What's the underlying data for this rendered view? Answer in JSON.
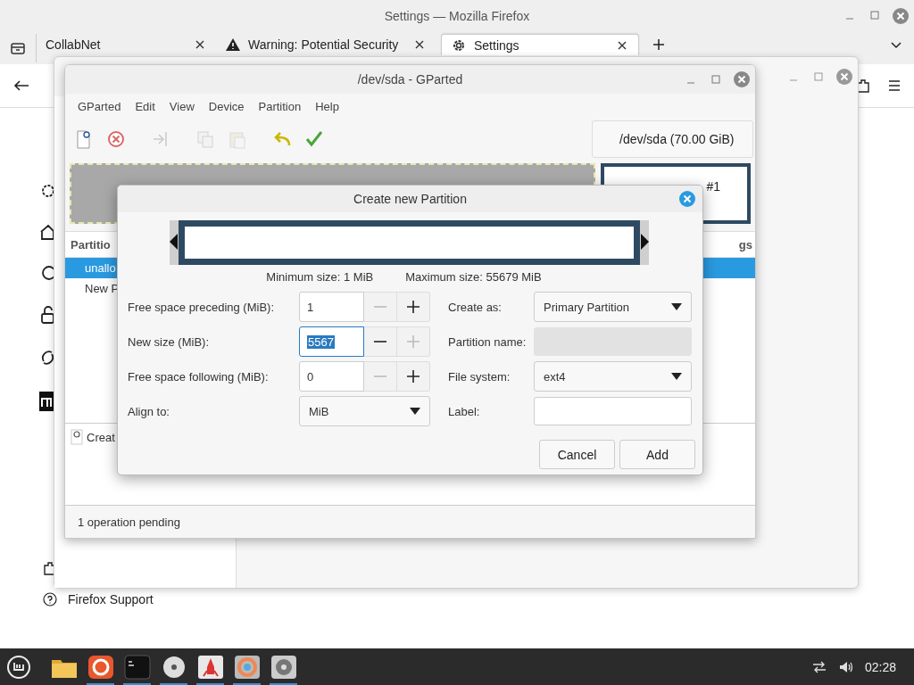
{
  "firefox": {
    "title": "Settings — Mozilla Firefox",
    "tabs": [
      {
        "label": "CollabNet",
        "kind": "plain",
        "selected": false
      },
      {
        "label": "Warning: Potential Security",
        "kind": "warning",
        "selected": false
      },
      {
        "label": "Settings",
        "kind": "settings",
        "selected": true
      }
    ],
    "support_link": "Firefox Support"
  },
  "gparted": {
    "title": "/dev/sda - GParted",
    "menu": [
      "GParted",
      "Edit",
      "View",
      "Device",
      "Partition",
      "Help"
    ],
    "toolbar": [
      {
        "kind": "new",
        "disabled": false
      },
      {
        "kind": "delete",
        "disabled": false
      },
      {
        "kind": "resize",
        "disabled": true
      },
      {
        "kind": "copy",
        "disabled": true
      },
      {
        "kind": "paste",
        "disabled": true
      },
      {
        "kind": "undo",
        "disabled": false
      },
      {
        "kind": "apply",
        "disabled": false
      }
    ],
    "device": "/dev/sda (70.00 GiB)",
    "map_label": "#1",
    "columns": [
      "Partitio",
      "gs"
    ],
    "rows": [
      {
        "text": "unallo",
        "selected": true
      },
      {
        "text": "New P",
        "selected": false
      }
    ],
    "operations": [
      "Creat"
    ],
    "status": "1 operation pending"
  },
  "dialog": {
    "title": "Create new Partition",
    "min_size": "Minimum size: 1 MiB",
    "max_size": "Maximum size: 55679 MiB",
    "left_fields": [
      {
        "label": "Free space preceding (MiB):",
        "kind": "spin",
        "value": "1",
        "text_selected": false,
        "minus_disabled": true,
        "plus_disabled": false
      },
      {
        "label": "New size (MiB):",
        "kind": "spin",
        "value": "5567",
        "text_selected": true,
        "minus_disabled": false,
        "plus_disabled": true
      },
      {
        "label": "Free space following (MiB):",
        "kind": "spin",
        "value": "0",
        "text_selected": false,
        "minus_disabled": true,
        "plus_disabled": false
      },
      {
        "label": "Align to:",
        "kind": "combo",
        "value": "MiB"
      }
    ],
    "right_fields": [
      {
        "label": "Create as:",
        "kind": "combo",
        "value": "Primary Partition"
      },
      {
        "label": "Partition name:",
        "kind": "entry",
        "disabled": true
      },
      {
        "label": "File system:",
        "kind": "combo",
        "value": "ext4"
      },
      {
        "label": "Label:",
        "kind": "entry",
        "disabled": false
      }
    ],
    "buttons": [
      "Cancel",
      "Add"
    ]
  },
  "taskbar": {
    "apps": [
      {
        "kind": "folder",
        "running": false
      },
      {
        "kind": "firefox",
        "running": true
      },
      {
        "kind": "terminal",
        "running": true
      },
      {
        "kind": "disc",
        "running": true
      },
      {
        "kind": "rocket",
        "running": true
      },
      {
        "kind": "ring",
        "running": true
      },
      {
        "kind": "disk",
        "running": true
      }
    ],
    "clock": "02:28"
  }
}
